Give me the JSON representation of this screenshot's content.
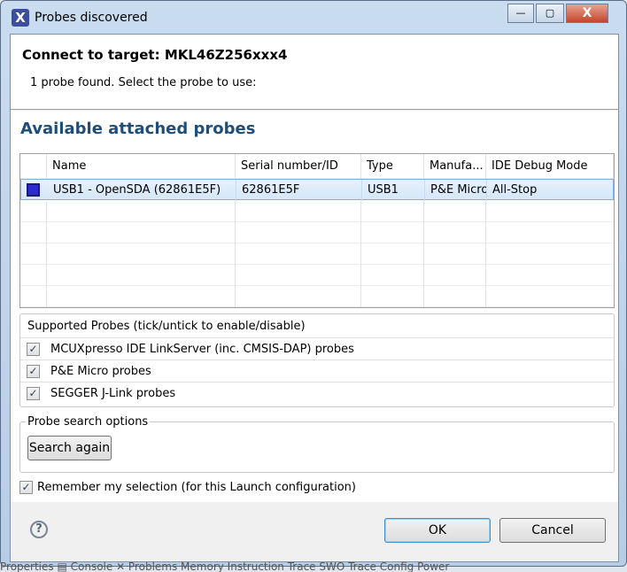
{
  "window": {
    "title": "Probes discovered",
    "minimize": "—",
    "maximize": "▢",
    "close": "X"
  },
  "header": {
    "title": "Connect to target: MKL46Z256xxx4",
    "subtitle": "1 probe found. Select the probe to use:"
  },
  "probes": {
    "title": "Available attached probes",
    "columns": [
      "Name",
      "Serial number/ID",
      "Type",
      "Manufa...",
      "IDE Debug Mode"
    ],
    "rows": [
      {
        "icon": "probe-icon",
        "name": "USB1 - OpenSDA (62861E5F)",
        "serial": "62861E5F",
        "type": "USB1",
        "manufacturer": "P&E Micro",
        "mode": "All-Stop",
        "selected": true
      }
    ]
  },
  "supported": {
    "label": "Supported Probes (tick/untick to enable/disable)",
    "items": [
      {
        "label": "MCUXpresso IDE LinkServer (inc. CMSIS-DAP) probes",
        "checked": true
      },
      {
        "label": "P&E Micro probes",
        "checked": true
      },
      {
        "label": "SEGGER J-Link probes",
        "checked": true
      }
    ]
  },
  "search": {
    "label": "Probe search options",
    "button": "Search again"
  },
  "remember": {
    "label": "Remember my selection (for this Launch configuration)",
    "checked": true
  },
  "footer": {
    "help": "?",
    "ok": "OK",
    "cancel": "Cancel"
  },
  "background_tabs": "Properties  ▤ Console ✕   Problems   Memory   Instruction Trace   SWO Trace Config   Power"
}
